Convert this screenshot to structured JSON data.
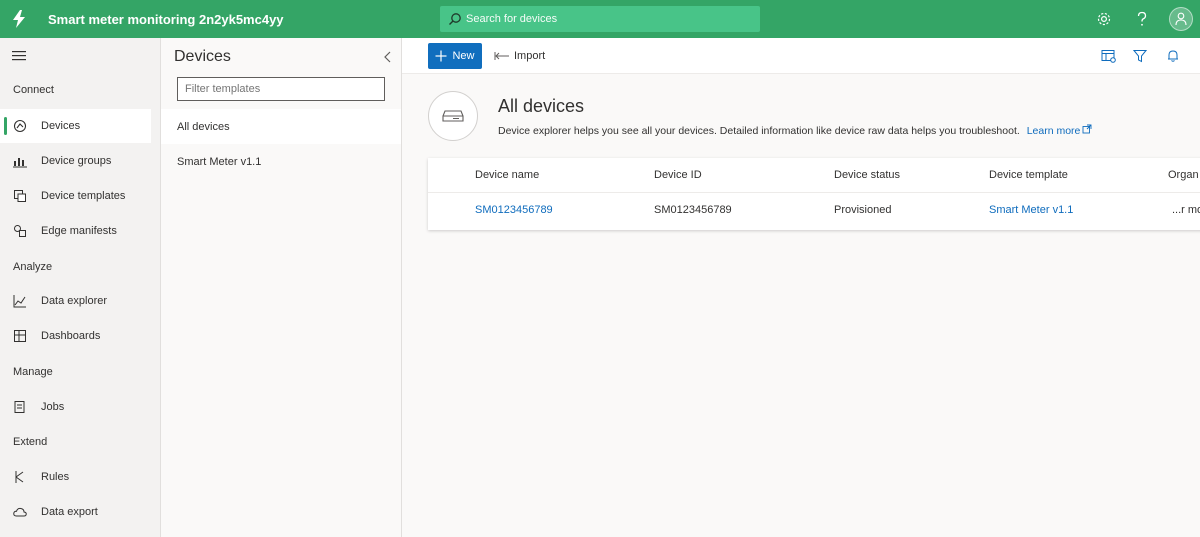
{
  "topbar": {
    "app_title": "Smart meter monitoring 2n2yk5mc4yy",
    "search_placeholder": "Search for devices"
  },
  "nav": {
    "sections": {
      "connect": "Connect",
      "analyze": "Analyze",
      "manage": "Manage",
      "extend": "Extend"
    },
    "items": {
      "devices": "Devices",
      "device_groups": "Device groups",
      "device_templates": "Device templates",
      "edge_manifests": "Edge manifests",
      "data_explorer": "Data explorer",
      "dashboards": "Dashboards",
      "jobs": "Jobs",
      "rules": "Rules",
      "data_export": "Data export"
    },
    "active": "devices"
  },
  "devices_panel": {
    "title": "Devices",
    "filter_placeholder": "Filter templates",
    "templates": [
      "All devices",
      "Smart Meter v1.1"
    ]
  },
  "toolbar": {
    "new_label": "New",
    "import_label": "Import"
  },
  "hero": {
    "title": "All devices",
    "description": "Device explorer helps you see all your devices. Detailed information like device raw data helps you troubleshoot.",
    "learn_more": "Learn more"
  },
  "table": {
    "columns": [
      "Device name",
      "Device ID",
      "Device status",
      "Device template",
      "Organ"
    ],
    "rows": [
      [
        "SM0123456789",
        "SM0123456789",
        "Provisioned",
        "Smart Meter v1.1",
        "...r mo"
      ]
    ]
  },
  "colors": {
    "brand_green": "#34a566",
    "primary_blue": "#106ebe",
    "link_blue": "#0f6cbd"
  }
}
